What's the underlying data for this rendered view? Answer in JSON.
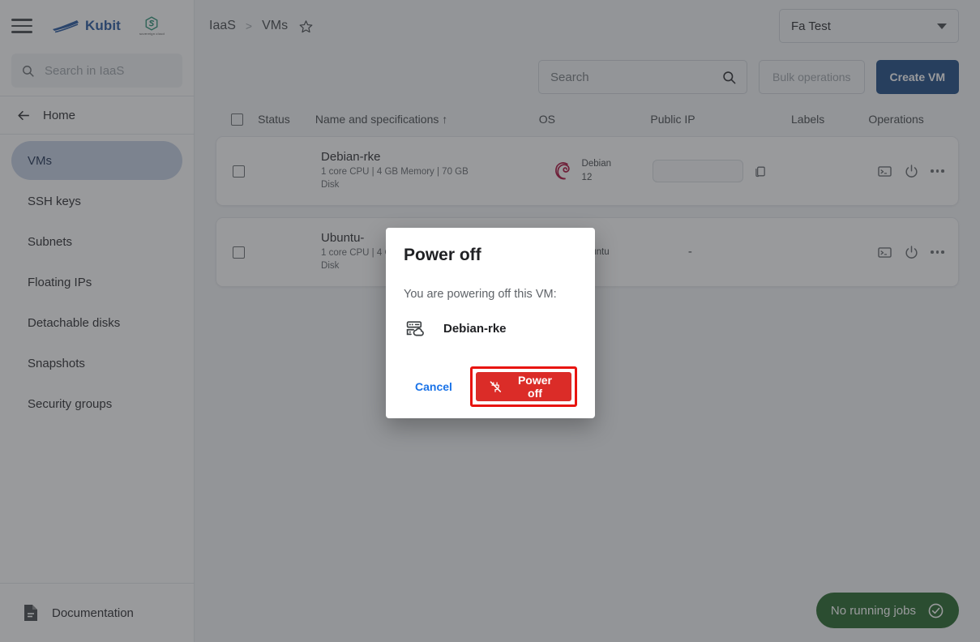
{
  "sidebar": {
    "brand_name": "Kubit",
    "partner_sub": "sovereign cloud",
    "search_placeholder": "Search in IaaS",
    "home_label": "Home",
    "items": [
      {
        "label": "VMs",
        "active": true
      },
      {
        "label": "SSH keys",
        "active": false
      },
      {
        "label": "Subnets",
        "active": false
      },
      {
        "label": "Floating IPs",
        "active": false
      },
      {
        "label": "Detachable disks",
        "active": false
      },
      {
        "label": "Snapshots",
        "active": false
      },
      {
        "label": "Security groups",
        "active": false
      }
    ],
    "documentation_label": "Documentation"
  },
  "topbar": {
    "breadcrumb_root": "IaaS",
    "breadcrumb_sep": ">",
    "breadcrumb_current": "VMs",
    "project_selected": "Fa Test"
  },
  "toolbar": {
    "search_placeholder": "Search",
    "search_value": "",
    "bulk_operations_label": "Bulk operations",
    "create_vm_label": "Create VM"
  },
  "table": {
    "columns": {
      "status": "Status",
      "name": "Name and specifications",
      "sort_indicator": "↑",
      "os": "OS",
      "public_ip": "Public IP",
      "labels": "Labels",
      "operations": "Operations"
    },
    "rows": [
      {
        "name": "Debian-rke",
        "specs": "1 core CPU | 4 GB Memory | 70 GB Disk",
        "status_color": "#14b814",
        "os_name": "Debian",
        "os_version": "12",
        "public_ip": "",
        "public_ip_redacted": true,
        "labels": ""
      },
      {
        "name": "Ubuntu-",
        "specs": "1 core CPU | 4 GB Memory | 70 GB Disk",
        "status_color": "#14b814",
        "os_name": "Ubuntu",
        "os_version": "",
        "public_ip": "-",
        "public_ip_redacted": false,
        "labels": ""
      }
    ]
  },
  "dialog": {
    "title": "Power off",
    "message": "You are powering off this VM:",
    "vm_name": "Debian-rke",
    "cancel_label": "Cancel",
    "confirm_label": "Power off",
    "highlight_color": "#e8140f",
    "confirm_color": "#db2c28"
  },
  "status_pill": {
    "label": "No running jobs",
    "color": "#1b5e20"
  }
}
